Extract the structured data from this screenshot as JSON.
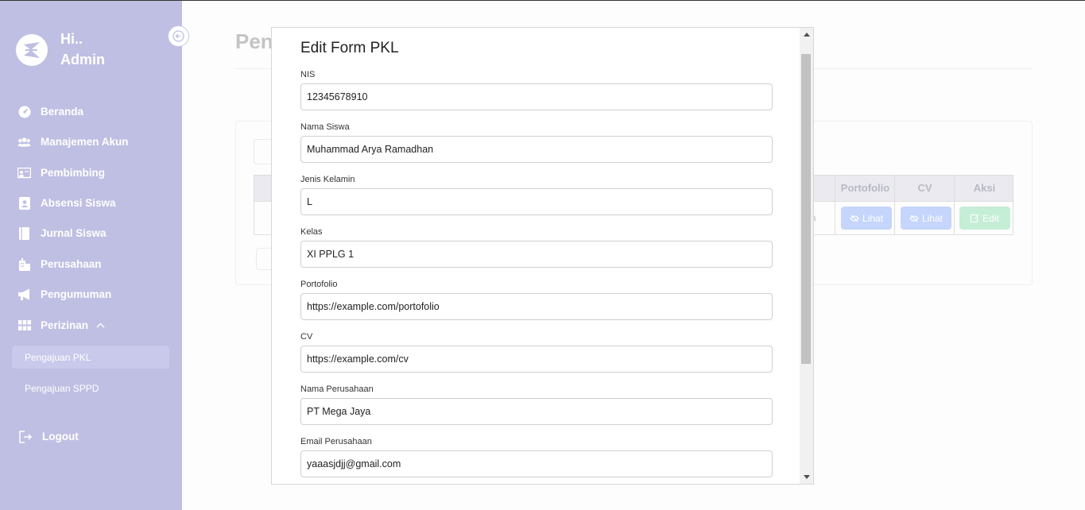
{
  "sidebar": {
    "greeting_line1": "Hi..",
    "greeting_line2": "Admin",
    "items": [
      {
        "label": "Beranda",
        "icon": "dashboard-icon"
      },
      {
        "label": "Manajemen Akun",
        "icon": "users-icon"
      },
      {
        "label": "Pembimbing",
        "icon": "chalkboard-teacher-icon"
      },
      {
        "label": "Absensi Siswa",
        "icon": "id-badge-icon"
      },
      {
        "label": "Jurnal Siswa",
        "icon": "book-icon"
      },
      {
        "label": "Perusahaan",
        "icon": "building-icon"
      },
      {
        "label": "Pengumuman",
        "icon": "megaphone-icon"
      },
      {
        "label": "Perizinan",
        "icon": "grid-icon"
      }
    ],
    "sub_items": [
      {
        "label": "Pengajuan PKL",
        "active": true
      },
      {
        "label": "Pengajuan SPPD",
        "active": false
      }
    ],
    "logout_label": "Logout"
  },
  "background": {
    "page_title": "Pen",
    "table_headers": [
      "Portofolio",
      "CV",
      "Aksi"
    ],
    "view_label": "Lihat",
    "edit_label": "Edit",
    "partial_cell": "a"
  },
  "modal": {
    "title": "Edit Form PKL",
    "fields": [
      {
        "label": "NIS",
        "value": "12345678910"
      },
      {
        "label": "Nama Siswa",
        "value": "Muhammad Arya Ramadhan"
      },
      {
        "label": "Jenis Kelamin",
        "value": "L"
      },
      {
        "label": "Kelas",
        "value": "XI PPLG 1"
      },
      {
        "label": "Portofolio",
        "value": "https://example.com/portofolio"
      },
      {
        "label": "CV",
        "value": "https://example.com/cv"
      },
      {
        "label": "Nama Perusahaan",
        "value": "PT Mega Jaya"
      },
      {
        "label": "Email Perusahaan",
        "value": "yaaasjdjj@gmail.com"
      }
    ]
  },
  "colors": {
    "sidebar_bg": "#bfbfe3",
    "primary_btn": "#c5d5fb",
    "success_btn": "#c5eed6"
  }
}
